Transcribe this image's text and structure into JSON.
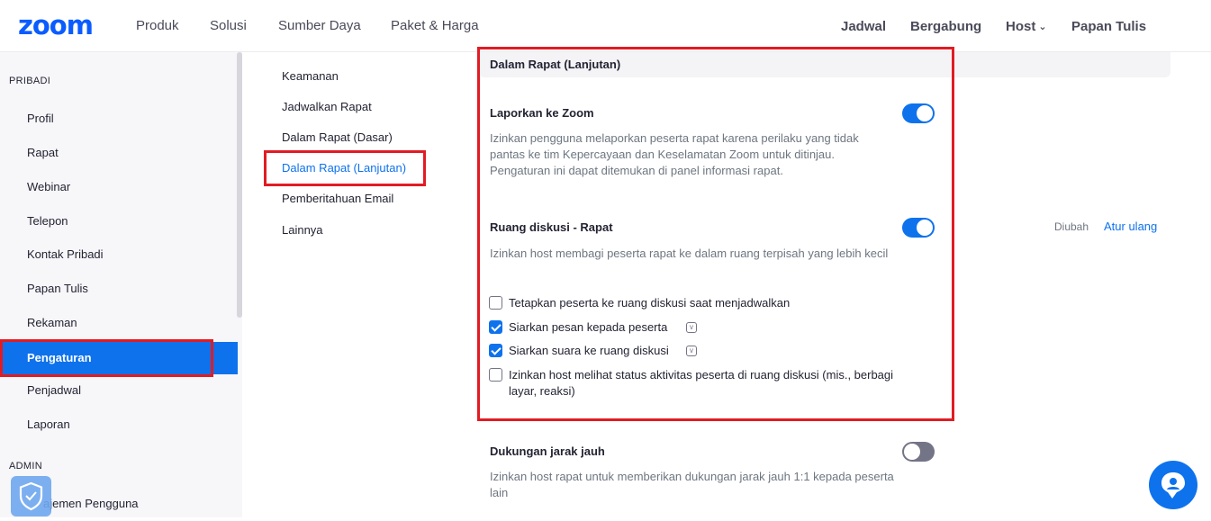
{
  "nav": {
    "logo": "zoom",
    "links": [
      "Produk",
      "Solusi",
      "Sumber Daya",
      "Paket & Harga"
    ],
    "right": {
      "schedule": "Jadwal",
      "join": "Bergabung",
      "host": "Host",
      "whiteboard": "Papan Tulis"
    }
  },
  "sidebar": {
    "personal_header": "PRIBADI",
    "items": [
      "Profil",
      "Rapat",
      "Webinar",
      "Telepon",
      "Kontak Pribadi",
      "Papan Tulis",
      "Rekaman",
      "Pengaturan",
      "Penjadwal",
      "Laporan"
    ],
    "active_item": "Pengaturan",
    "admin_header": "ADMIN",
    "admin_items": [
      "ajemen Pengguna"
    ]
  },
  "settings_menu": {
    "items": [
      "Keamanan",
      "Jadwalkan Rapat",
      "Dalam Rapat (Dasar)",
      "Dalam Rapat (Lanjutan)",
      "Pemberitahuan Email",
      "Lainnya"
    ],
    "active": "Dalam Rapat (Lanjutan)"
  },
  "content": {
    "section_title": "Dalam Rapat (Lanjutan)",
    "settings": [
      {
        "title": "Laporkan ke Zoom",
        "description": "Izinkan pengguna melaporkan peserta rapat karena perilaku yang tidak pantas ke tim Kepercayaan dan Keselamatan Zoom untuk ditinjau. Pengaturan ini dapat ditemukan di panel informasi rapat.",
        "enabled": true
      },
      {
        "title": "Ruang diskusi - Rapat",
        "description": "Izinkan host membagi peserta rapat ke dalam ruang terpisah yang lebih kecil",
        "enabled": true,
        "modified_label": "Diubah",
        "reset_label": "Atur ulang",
        "options": [
          {
            "label": "Tetapkan peserta ke ruang diskusi saat menjadwalkan",
            "checked": false
          },
          {
            "label": "Siarkan pesan kepada peserta",
            "checked": true
          },
          {
            "label": "Siarkan suara ke ruang diskusi",
            "checked": true
          },
          {
            "label": "Izinkan host melihat status aktivitas peserta di ruang diskusi (mis., berbagi layar, reaksi)",
            "checked": false
          }
        ]
      },
      {
        "title": "Dukungan jarak jauh",
        "description": "Izinkan host rapat untuk memberikan dukungan jarak jauh 1:1 kepada peserta lain",
        "enabled": false
      }
    ]
  },
  "colors": {
    "brand": "#0b5cff",
    "accent": "#0e72ed",
    "highlight_box": "#e21b23"
  }
}
